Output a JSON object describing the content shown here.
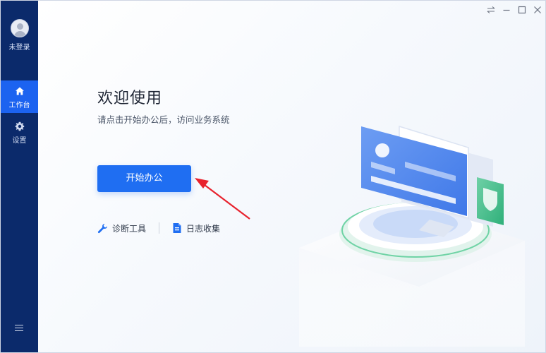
{
  "sidebar": {
    "user_label": "未登录",
    "items": [
      {
        "label": "工作台",
        "icon": "home-icon",
        "active": true
      },
      {
        "label": "设置",
        "icon": "gear-icon",
        "active": false
      }
    ],
    "menu_icon": "menu-icon"
  },
  "titlebar": {
    "icons": [
      "switch-icon",
      "minimize-icon",
      "maximize-icon",
      "close-icon"
    ]
  },
  "main": {
    "title": "欢迎使用",
    "subtitle": "请点击开始办公后，访问业务系统",
    "start_button": "开始办公",
    "tools": [
      {
        "label": "诊断工具",
        "icon": "wrench-icon"
      },
      {
        "label": "日志收集",
        "icon": "document-icon"
      }
    ]
  },
  "colors": {
    "sidebar_bg": "#0b2a6b",
    "accent": "#1f6ef2",
    "arrow": "#e8222d"
  }
}
